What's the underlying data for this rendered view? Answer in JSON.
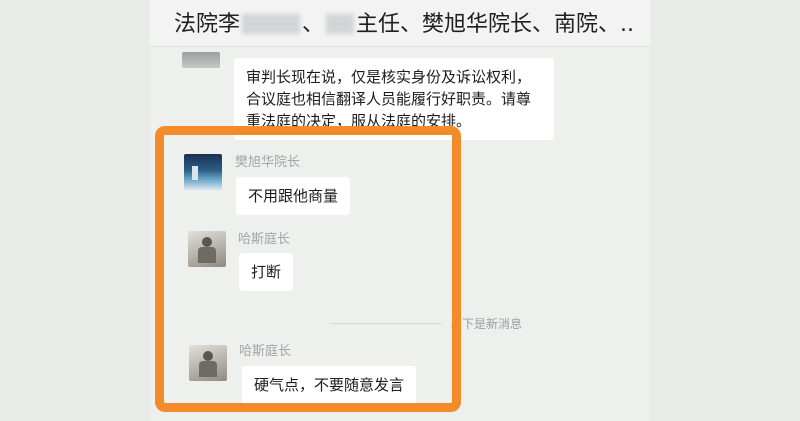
{
  "header": {
    "title_part1": "法院李",
    "title_part2": "主任、樊旭华院长、南院、.."
  },
  "messages": [
    {
      "text": "审判长现在说，仅是核实身份及诉讼权利，合议庭也相信翻译人员能履行好职责。请尊重法庭的决定，服从法庭的安排。"
    },
    {
      "sender": "樊旭华院长",
      "text": "不用跟他商量"
    },
    {
      "sender": "哈斯庭长",
      "text": "打断"
    },
    {
      "sender": "哈斯庭长",
      "text": "硬气点，不要随意发言"
    }
  ],
  "separator": "以下是新消息",
  "colors": {
    "highlight": "#f28c2a",
    "background": "#eef0ee"
  }
}
